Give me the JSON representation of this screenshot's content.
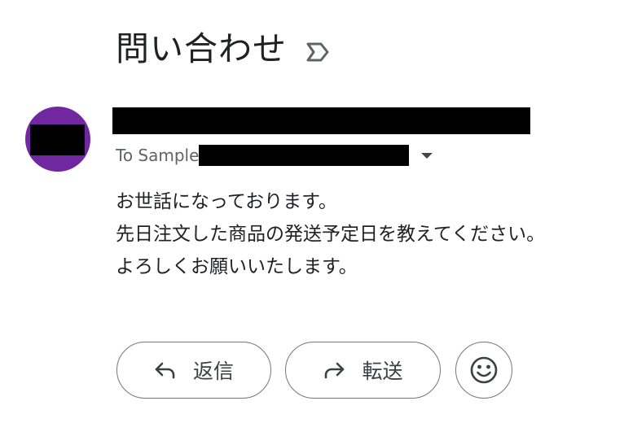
{
  "email": {
    "subject": "問い合わせ",
    "sender_redacted": true,
    "recipient_prefix": "To Sample",
    "body_lines": [
      "お世話になっております。",
      "先日注文した商品の発送予定日を教えてください。",
      "よろしくお願いいたします。"
    ]
  },
  "actions": {
    "reply_label": "返信",
    "forward_label": "転送"
  },
  "icons": {
    "important": "important-marker-icon",
    "details": "caret-down-icon",
    "reply": "reply-arrow-icon",
    "forward": "forward-arrow-icon",
    "emoji": "smiley-face-icon"
  },
  "colors": {
    "avatar": "#7027a0",
    "text": "#202124",
    "secondary_text": "#5f6368",
    "button_border": "#747775"
  }
}
